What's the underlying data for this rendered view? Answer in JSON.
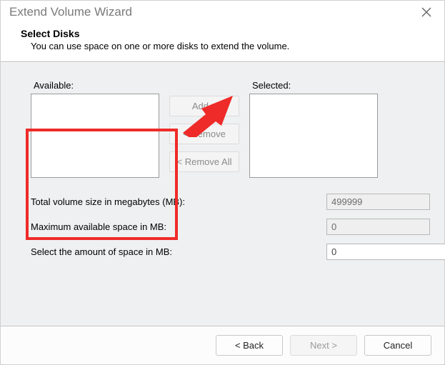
{
  "window": {
    "title": "Extend Volume Wizard"
  },
  "header": {
    "title": "Select Disks",
    "subtitle": "You can use space on one or more disks to extend the volume."
  },
  "lists": {
    "available_label": "Available:",
    "selected_label": "Selected:",
    "available_items": [],
    "selected_items": []
  },
  "mid_buttons": {
    "add": "Add >",
    "remove": "< Remove",
    "remove_all": "< Remove All"
  },
  "fields": {
    "total_label": "Total volume size in megabytes (MB):",
    "total_value": "499999",
    "max_label": "Maximum available space in MB:",
    "max_value": "0",
    "amount_label": "Select the amount of space in MB:",
    "amount_value": "0"
  },
  "footer": {
    "back": "< Back",
    "next": "Next >",
    "cancel": "Cancel"
  },
  "annotation": {
    "highlight_color": "#ee2b29"
  }
}
